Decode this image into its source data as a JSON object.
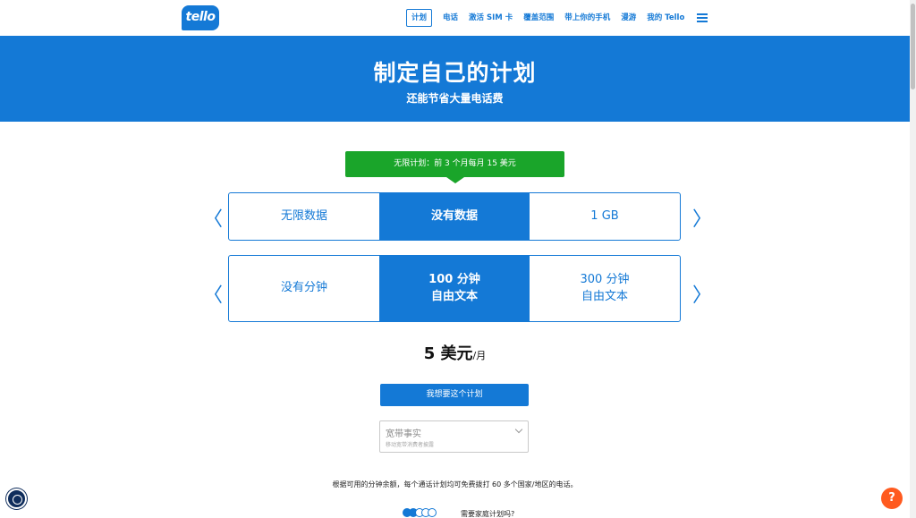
{
  "header": {
    "logo": "tello",
    "nav": [
      "计划",
      "电话",
      "激活 SIM 卡",
      "覆盖范围",
      "带上你的手机",
      "漫游",
      "我的 Tello"
    ]
  },
  "hero": {
    "title": "制定自己的计划",
    "subtitle": "还能节省大量电话费"
  },
  "promo": "无限计划：前 3 个月每月 15 美元",
  "data_options": [
    "无限数据",
    "没有数据",
    "1 GB"
  ],
  "minute_options": [
    {
      "line1": "没有分钟",
      "line2": ""
    },
    {
      "line1": "100 分钟",
      "line2": "自由文本"
    },
    {
      "line1": "300 分钟",
      "line2": "自由文本"
    }
  ],
  "arrows": {
    "left": "〈",
    "right": "〉"
  },
  "price": {
    "amount": "5 美元",
    "per": "/月"
  },
  "cta": "我想要这个计划",
  "broadband": {
    "title": "宽带事实",
    "subtitle": "移动宽带消费者披露"
  },
  "note": "根据可用的分钟余额，每个通话计划均可免费拨打 60 多个国家/地区的电话。",
  "family": "需要家庭计划吗?",
  "help_icon": "?",
  "colors": {
    "brand": "#1479d6",
    "promo": "#1aa52a",
    "help": "#ff5a1f"
  }
}
